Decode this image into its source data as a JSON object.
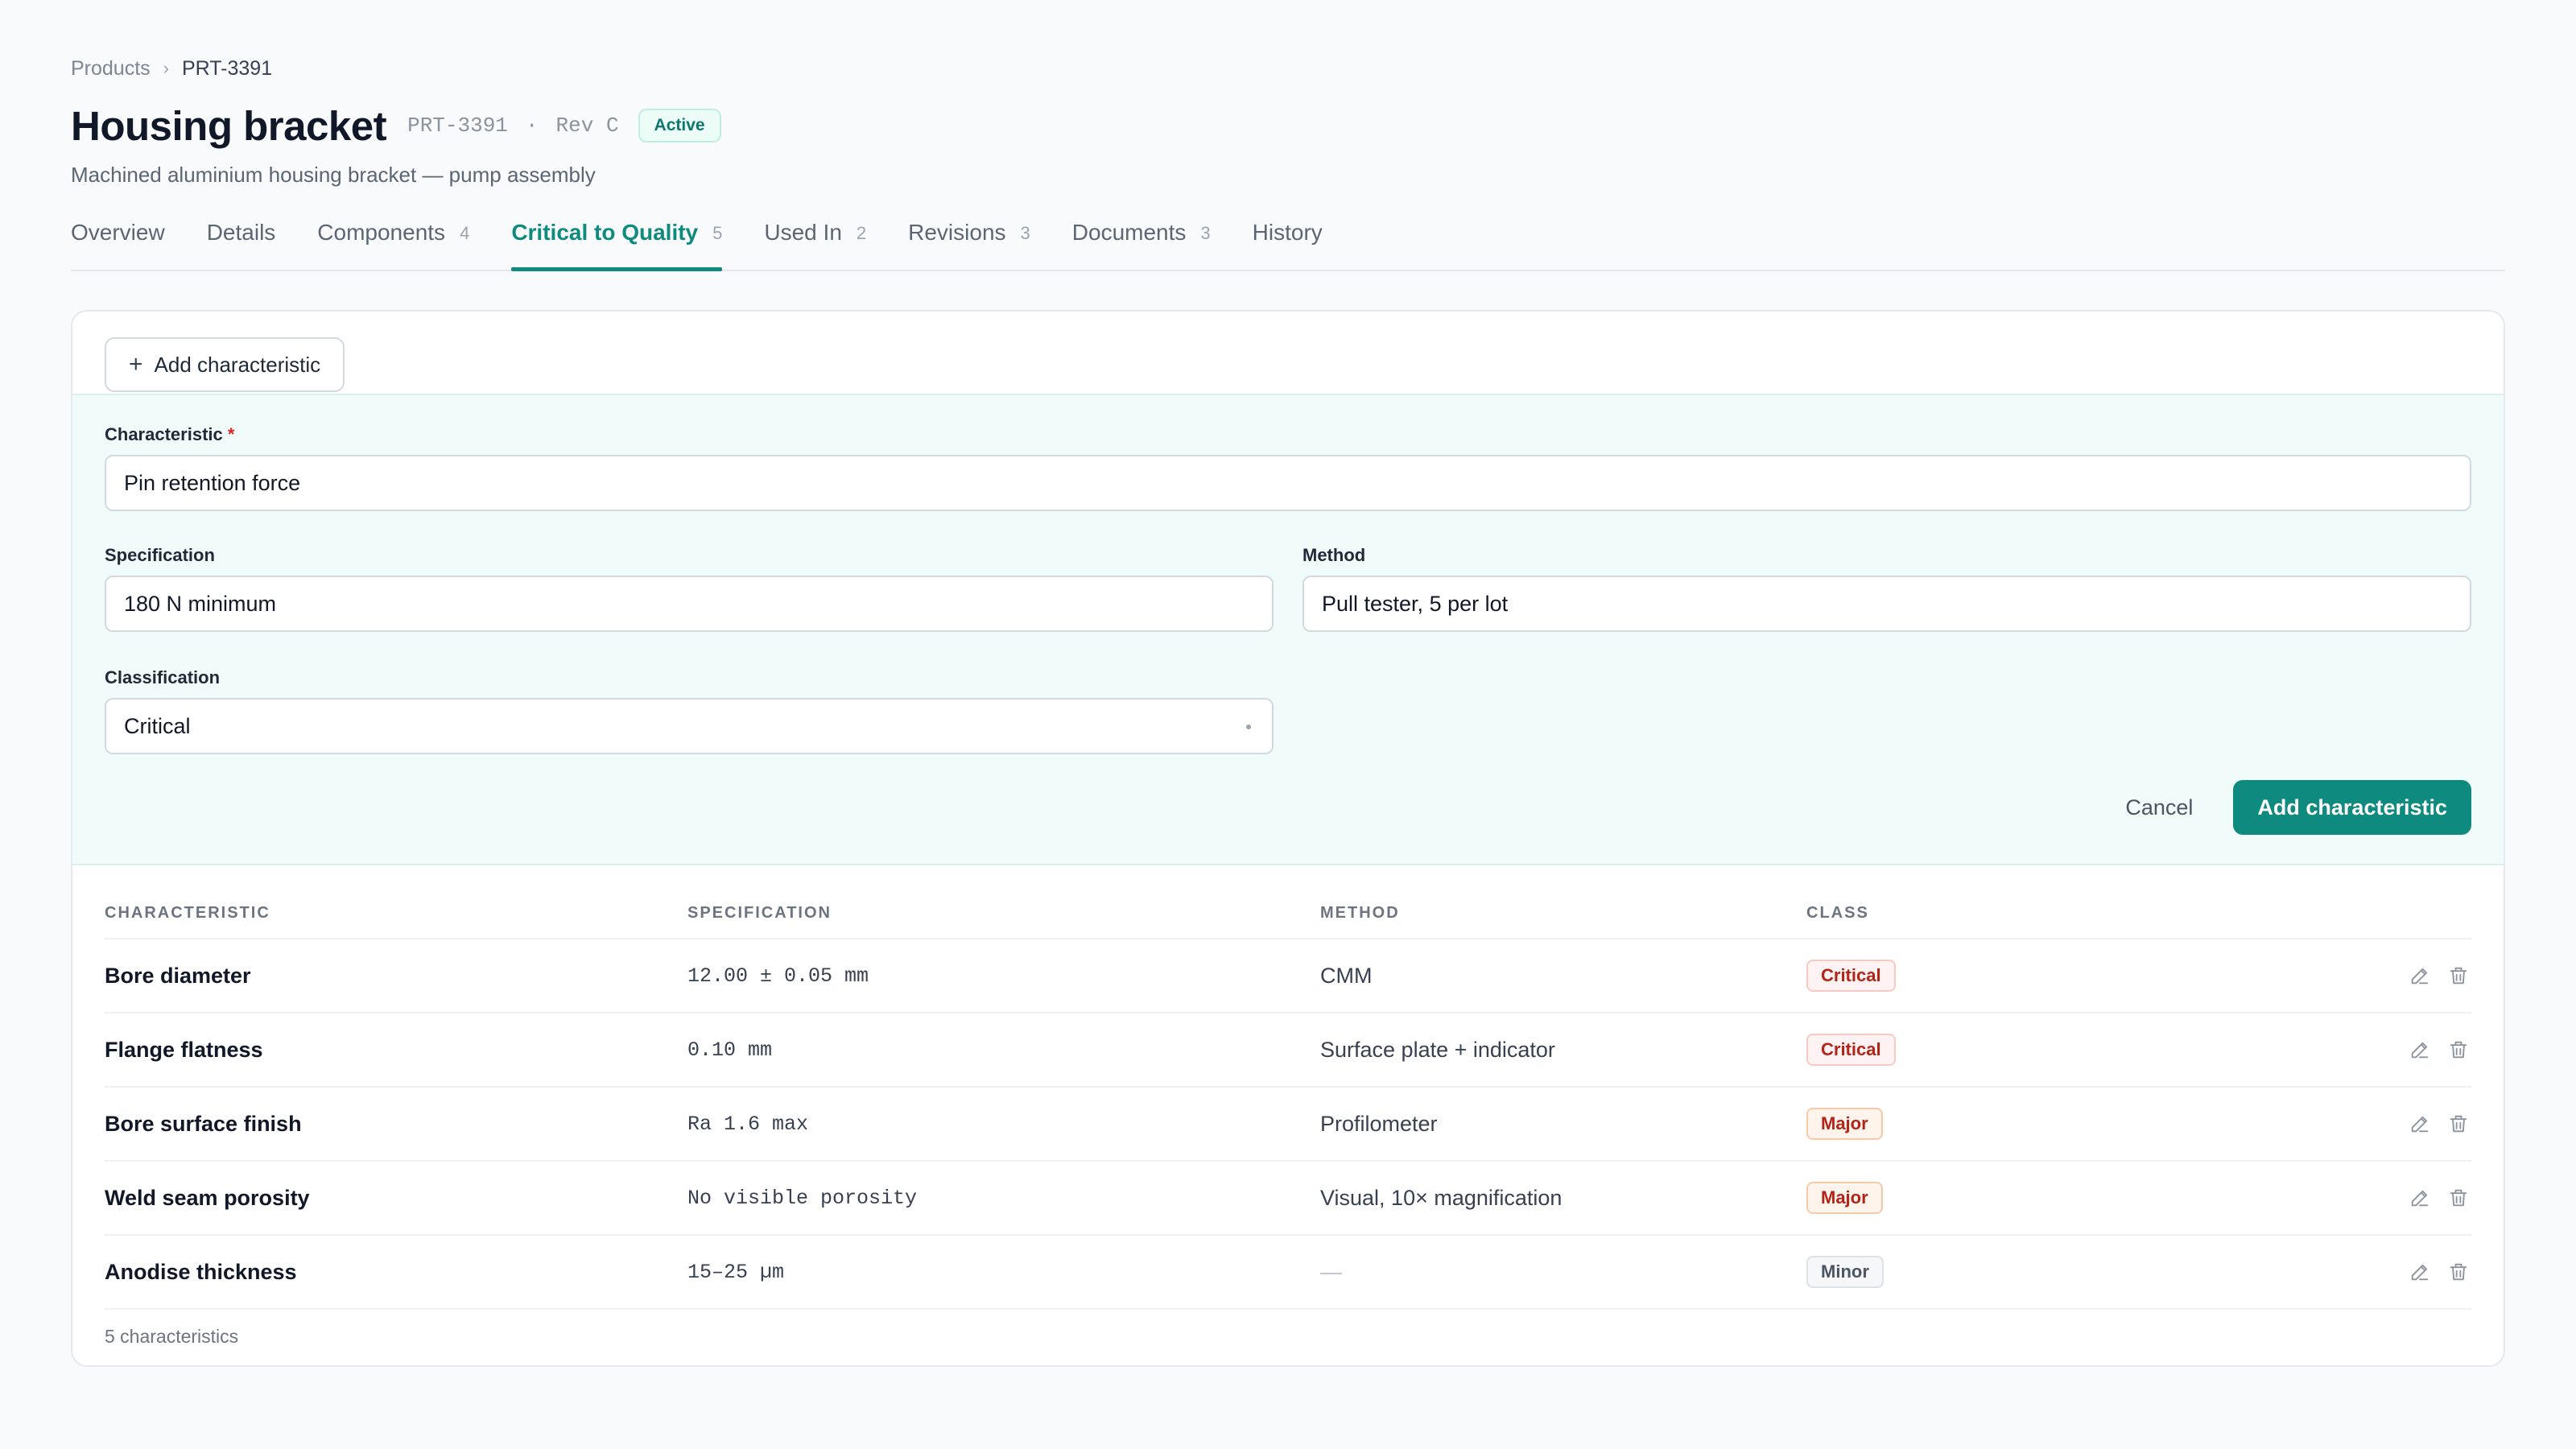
{
  "breadcrumb": {
    "parent": "Products",
    "separator": "›",
    "current": "PRT-3391"
  },
  "header": {
    "title": "Housing bracket",
    "part_number": "PRT-3391",
    "separator": "·",
    "revision": "Rev C",
    "status": "Active",
    "subtitle": "Machined aluminium housing bracket — pump assembly"
  },
  "tabs": [
    {
      "label": "Overview",
      "count": ""
    },
    {
      "label": "Details",
      "count": ""
    },
    {
      "label": "Components",
      "count": "4"
    },
    {
      "label": "Critical to Quality",
      "count": "5",
      "active": true
    },
    {
      "label": "Used In",
      "count": "2"
    },
    {
      "label": "Revisions",
      "count": "3"
    },
    {
      "label": "Documents",
      "count": "3"
    },
    {
      "label": "History",
      "count": ""
    }
  ],
  "toolbar": {
    "add_label": "Add characteristic",
    "add_icon": "plus-icon"
  },
  "form": {
    "characteristic_label": "Characteristic",
    "required_mark": "*",
    "characteristic_value": "Pin retention force",
    "specification_label": "Specification",
    "specification_value": "180 N minimum",
    "method_label": "Method",
    "method_value": "Pull tester, 5 per lot",
    "classification_label": "Classification",
    "classification_value": "Critical",
    "cancel_label": "Cancel",
    "submit_label": "Add characteristic"
  },
  "table": {
    "headers": {
      "characteristic": "CHARACTERISTIC",
      "specification": "SPECIFICATION",
      "method": "METHOD",
      "class": "CLASS"
    },
    "rows": [
      {
        "characteristic": "Bore diameter",
        "specification": "12.00 ± 0.05 mm",
        "method": "CMM",
        "class": "Critical",
        "severity": "critical"
      },
      {
        "characteristic": "Flange flatness",
        "specification": "0.10 mm",
        "method": "Surface plate + indicator",
        "class": "Critical",
        "severity": "critical"
      },
      {
        "characteristic": "Bore surface finish",
        "specification": "Ra 1.6 max",
        "method": "Profilometer",
        "class": "Major",
        "severity": "major"
      },
      {
        "characteristic": "Weld seam porosity",
        "specification": "No visible porosity",
        "method": "Visual, 10× magnification",
        "class": "Major",
        "severity": "major"
      },
      {
        "characteristic": "Anodise thickness",
        "specification": "15–25 µm",
        "method": "—",
        "class": "Minor",
        "severity": "minor"
      }
    ],
    "footer": "5 characteristics"
  },
  "colors": {
    "accent": "#0f8a7e",
    "critical": "#b42318",
    "minor": "#4b5563"
  }
}
